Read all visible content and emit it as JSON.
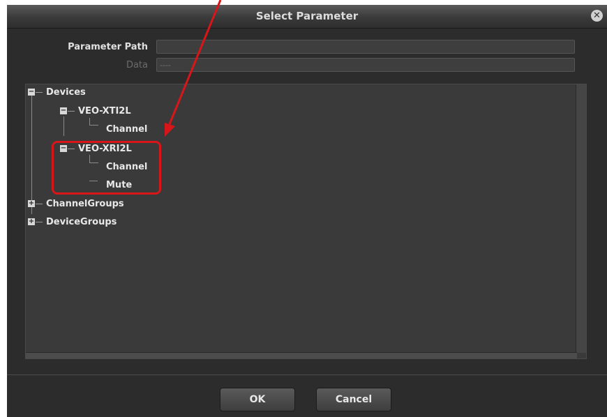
{
  "dialog": {
    "title": "Select Parameter",
    "close_glyph": "✕"
  },
  "fields": {
    "parameter_path": {
      "label": "Parameter Path",
      "value": ""
    },
    "data": {
      "label": "Data",
      "value": "----"
    }
  },
  "tree": {
    "devices": {
      "label": "Devices",
      "children": {
        "veo_xti2l": {
          "label": "VEO-XTI2L",
          "channel": "Channel"
        },
        "veo_xri2l": {
          "label": "VEO-XRI2L",
          "channel": "Channel",
          "mute": "Mute"
        }
      }
    },
    "channel_groups": {
      "label": "ChannelGroups"
    },
    "device_groups": {
      "label": "DeviceGroups"
    }
  },
  "buttons": {
    "ok": "OK",
    "cancel": "Cancel"
  },
  "colors": {
    "annotation": "#d8161a",
    "dialog_bg": "#2c2c2c",
    "panel_bg": "#3a3a3a"
  },
  "icons": {
    "expanded": "minus-box-icon",
    "collapsed": "plus-box-icon"
  }
}
